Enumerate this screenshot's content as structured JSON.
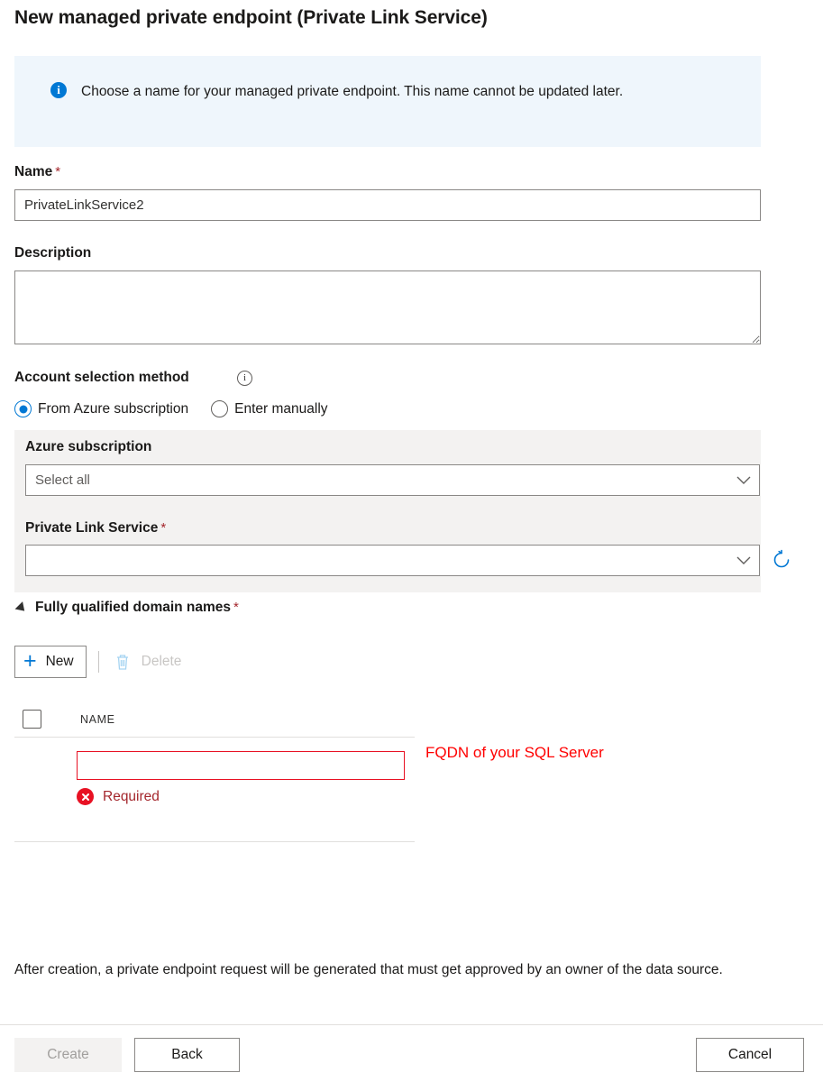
{
  "page": {
    "title": "New managed private endpoint (Private Link Service)"
  },
  "info_banner": {
    "icon": "info-circle-icon",
    "text": "Choose a name for your managed private endpoint. This name cannot be updated later."
  },
  "form": {
    "name": {
      "label": "Name",
      "required_marker": "*",
      "value": "PrivateLinkService2",
      "placeholder": ""
    },
    "description": {
      "label": "Description",
      "value": "",
      "placeholder": ""
    },
    "account_selection": {
      "label": "Account selection method",
      "info_icon": "info-outline-icon",
      "options": [
        {
          "label": "From Azure subscription",
          "selected": true
        },
        {
          "label": "Enter manually",
          "selected": false
        }
      ]
    },
    "azure_subscription": {
      "label": "Azure subscription",
      "value": "Select all",
      "chevron": "chevron-down-icon"
    },
    "private_link_service": {
      "label": "Private Link Service",
      "required_marker": "*",
      "value": "",
      "chevron": "chevron-down-icon",
      "refresh_icon": "refresh-icon"
    }
  },
  "fqdn_section": {
    "title": "Fully qualified domain names",
    "required_marker": "*",
    "expanded": true,
    "toolbar": {
      "new_label": "New",
      "new_icon": "plus-icon",
      "delete_label": "Delete",
      "delete_icon": "trash-icon",
      "delete_disabled": true
    },
    "table": {
      "columns": [
        "NAME"
      ],
      "rows": [
        {
          "name_value": "",
          "error": "Required",
          "error_icon": "error-circle-icon"
        }
      ]
    },
    "annotation": "FQDN of your SQL Server"
  },
  "footer": {
    "note": "After creation, a private endpoint request will be generated that must get approved by an owner of the data source.",
    "buttons": {
      "create": "Create",
      "back": "Back",
      "cancel": "Cancel"
    }
  },
  "colors": {
    "accent": "#0078d4",
    "info_banner_bg": "#eff6fc",
    "panel_bg": "#f3f2f1",
    "error": "#e81123",
    "required_star": "#a4262c",
    "annotation": "#ff0000"
  }
}
